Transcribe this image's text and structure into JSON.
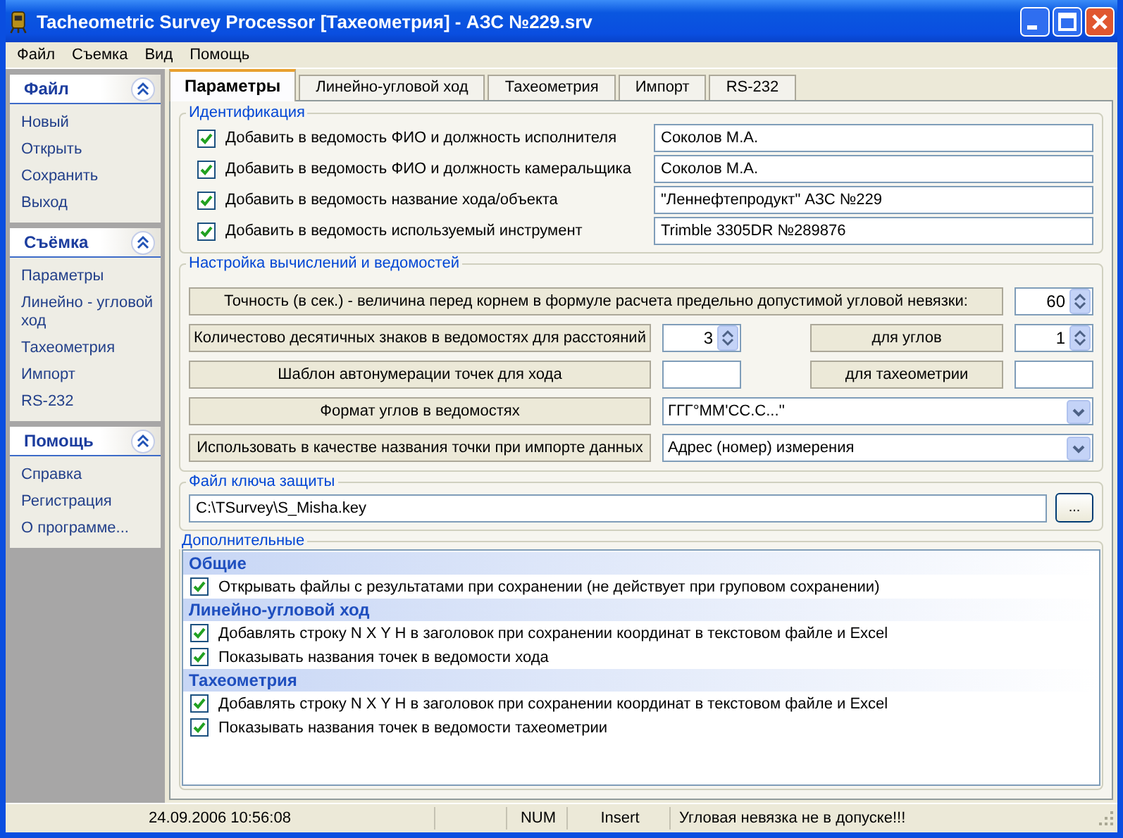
{
  "window": {
    "title": "Tacheometric Survey Processor [Тахеометрия] - АЗС №229.srv"
  },
  "menu": [
    "Файл",
    "Съемка",
    "Вид",
    "Помощь"
  ],
  "sidebar": {
    "sections": [
      {
        "title": "Файл",
        "expanded": true,
        "items": [
          "Новый",
          "Открыть",
          "Сохранить",
          "Выход"
        ]
      },
      {
        "title": "Съёмка",
        "expanded": true,
        "items": [
          "Параметры",
          "Линейно - угловой ход",
          "Тахеометрия",
          "Импорт",
          "RS-232"
        ]
      },
      {
        "title": "Помощь",
        "expanded": true,
        "items": [
          "Справка",
          "Регистрация",
          "О программе..."
        ]
      }
    ]
  },
  "tabs": [
    {
      "label": "Параметры",
      "selected": true
    },
    {
      "label": "Линейно-угловой ход",
      "selected": false
    },
    {
      "label": "Тахеометрия",
      "selected": false
    },
    {
      "label": "Импорт",
      "selected": false
    },
    {
      "label": "RS-232",
      "selected": false
    }
  ],
  "identification": {
    "title": "Идентификация",
    "rows": [
      {
        "label": "Добавить в ведомость ФИО и должность исполнителя",
        "checked": true,
        "value": "Соколов М.А."
      },
      {
        "label": "Добавить в ведомость ФИО и должность камеральщика",
        "checked": true,
        "value": "Соколов М.А."
      },
      {
        "label": "Добавить в ведомость название хода/объекта",
        "checked": true,
        "value": "\"Леннефтепродукт\" АЗС №229"
      },
      {
        "label": "Добавить в ведомость используемый инструмент",
        "checked": true,
        "value": "Trimble 3305DR №289876"
      }
    ]
  },
  "settings": {
    "title": "Настройка вычислений и ведомостей",
    "precision": {
      "label": "Точность (в сек.) - величина перед корнем в формуле расчета предельно допустимой угловой невязки:",
      "value": "60"
    },
    "decimals": {
      "label": "Количестово десятичных знаков в ведомостях для расстояний",
      "value": "3",
      "angle_label": "для углов",
      "angle_value": "1"
    },
    "autonum": {
      "label": "Шаблон автонумерации точек для хода",
      "taxe_label": "для тахеометрии"
    },
    "angle_format": {
      "label": "Формат углов в ведомостях",
      "value": "ГГГ°ММ'СС.С...''"
    },
    "import_name": {
      "label": "Использовать в качестве названия точки при импорте данных",
      "value": "Адрес (номер) измерения"
    }
  },
  "key_file": {
    "title": "Файл ключа защиты",
    "value": "C:\\TSurvey\\S_Misha.key",
    "button": "..."
  },
  "additional": {
    "title": "Дополнительные",
    "groups": [
      {
        "title": "Общие",
        "items": [
          {
            "label": "Открывать файлы с результатами при сохранении (не действует при груповом сохранении)",
            "checked": true
          }
        ]
      },
      {
        "title": "Линейно-угловой ход",
        "items": [
          {
            "label": "Добавлять строку N X Y H в заголовок при сохранении координат в текстовом файле и Excel",
            "checked": true
          },
          {
            "label": "Показывать названия точек в ведомости хода",
            "checked": true
          }
        ]
      },
      {
        "title": "Тахеометрия",
        "items": [
          {
            "label": "Добавлять строку N X Y H в заголовок при сохранении координат в текстовом файле и Excel",
            "checked": true
          },
          {
            "label": "Показывать названия точек в ведомости тахеометрии",
            "checked": true
          }
        ]
      }
    ]
  },
  "status_bar": [
    {
      "text": "24.09.2006 10:56:08"
    },
    {
      "text": "NUM"
    },
    {
      "text": "Insert"
    },
    {
      "text": "Угловая невязка не в допуске!!!"
    }
  ]
}
